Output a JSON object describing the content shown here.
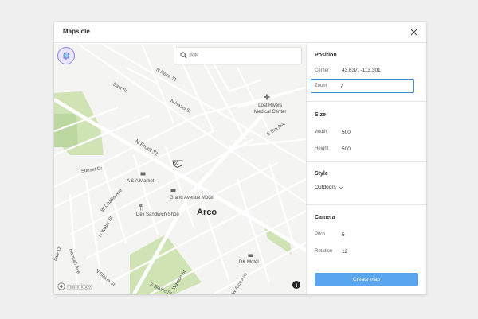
{
  "window": {
    "title": "Mapsicle"
  },
  "search": {
    "placeholder": "搜索"
  },
  "map": {
    "streets": {
      "n_rena": "N Rena St",
      "east": "East St",
      "n_hazel": "N Hazel St",
      "n_front": "N Front St",
      "sunset": "Sunset Dr",
      "w_challis": "W Challis Ave",
      "n_water": "N Water St",
      "hannah": "Hannah Ave",
      "n_blaine": "N Blaine St",
      "s_blaine": "S Blaine St",
      "e_era": "E Era Ave",
      "w_arco": "W Arco Ave",
      "watson": "Watson St",
      "side": "lade Dr"
    },
    "pois": {
      "hospital": "Lost Rivers\nMedical Center",
      "market": "A & A Market",
      "motel": "Grand Avenue Motel",
      "deli": "Deli Sandwich Shop",
      "dk_motel": "DK Motel"
    },
    "city": "Arco",
    "route_shield": "93",
    "attribution": "mapbox"
  },
  "panel": {
    "position": {
      "title": "Position",
      "center_label": "Center",
      "center_value": "43.637, -113.301",
      "zoom_label": "Zoom",
      "zoom_value": "7"
    },
    "size": {
      "title": "Size",
      "width_label": "Width",
      "width_value": "500",
      "height_label": "Height",
      "height_value": "500"
    },
    "style": {
      "title": "Style",
      "selected": "Outdoors"
    },
    "camera": {
      "title": "Camera",
      "pitch_label": "Pitch",
      "pitch_value": "5",
      "rotation_label": "Rotation",
      "rotation_value": "12"
    },
    "create_label": "Create map"
  },
  "colors": {
    "accent": "#5aa6ee",
    "focus_border": "#3f8fd8",
    "park": "#cfe3b4",
    "road": "#ffffff",
    "logo_purple": "#8c80e8"
  }
}
